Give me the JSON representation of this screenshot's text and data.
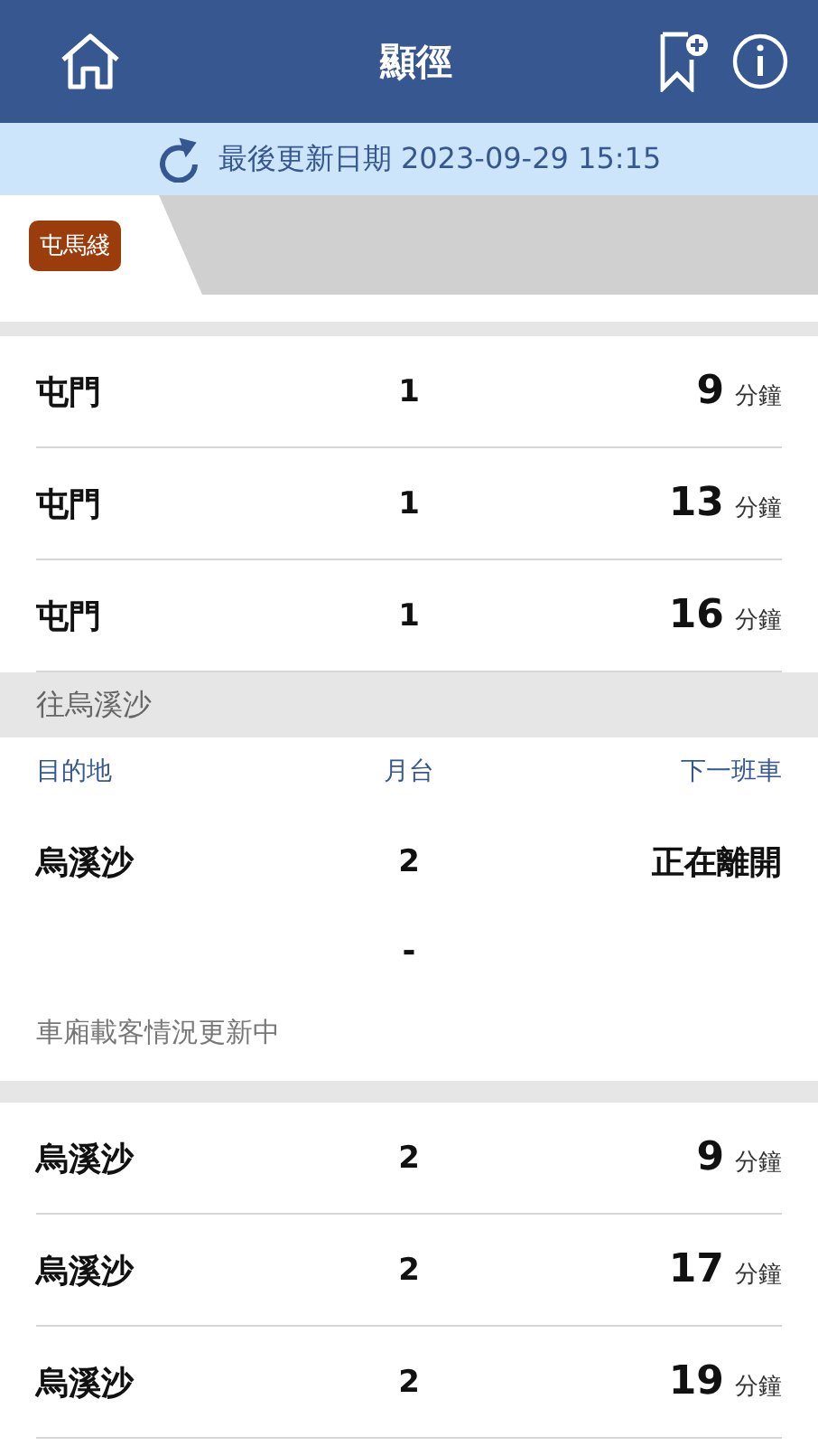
{
  "header": {
    "title": "顯徑"
  },
  "update_bar": {
    "text": "最後更新日期 2023-09-29 15:15"
  },
  "line_tabs": [
    {
      "label": "屯馬綫",
      "selected": true
    }
  ],
  "upper_trains": [
    {
      "destination": "屯門",
      "platform": "1",
      "minutes": "9",
      "unit": "分鐘"
    },
    {
      "destination": "屯門",
      "platform": "1",
      "minutes": "13",
      "unit": "分鐘"
    },
    {
      "destination": "屯門",
      "platform": "1",
      "minutes": "16",
      "unit": "分鐘"
    }
  ],
  "direction": {
    "title": "往烏溪沙",
    "columns": [
      "目的地",
      "月台",
      "下一班車"
    ],
    "next_train": {
      "destination": "烏溪沙",
      "platform": "2",
      "status": "正在離開"
    },
    "dash": "-",
    "load_note": "車廂載客情況更新中",
    "trains": [
      {
        "destination": "烏溪沙",
        "platform": "2",
        "minutes": "9",
        "unit": "分鐘"
      },
      {
        "destination": "烏溪沙",
        "platform": "2",
        "minutes": "17",
        "unit": "分鐘"
      },
      {
        "destination": "烏溪沙",
        "platform": "2",
        "minutes": "19",
        "unit": "分鐘"
      }
    ]
  }
}
